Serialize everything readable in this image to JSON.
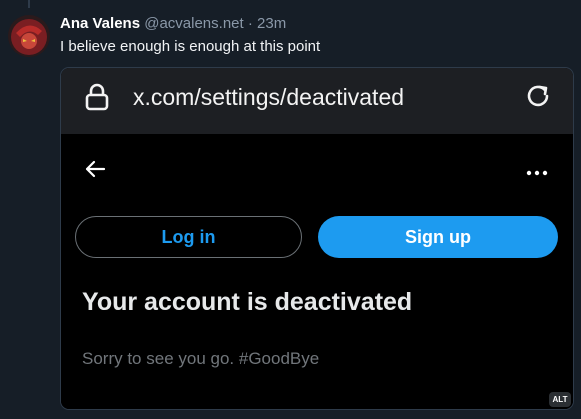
{
  "post": {
    "author_name": "Ana Valens",
    "author_handle": "@acvalens.net",
    "separator": "·",
    "time": "23m",
    "text": "I believe enough is enough at this point"
  },
  "embed": {
    "browser": {
      "url": "x.com/settings/deactivated",
      "icons": [
        "lock-icon",
        "reload-icon"
      ]
    },
    "page": {
      "icons": [
        "back-arrow-icon",
        "more-icon"
      ],
      "login_label": "Log in",
      "signup_label": "Sign up",
      "title": "Your account is deactivated",
      "message": "Sorry to see you go. #GoodBye"
    },
    "alt_badge": "ALT"
  },
  "colors": {
    "background": "#161e27",
    "x_blue": "#1d9bf0",
    "secondary_text": "#8a98a8"
  }
}
